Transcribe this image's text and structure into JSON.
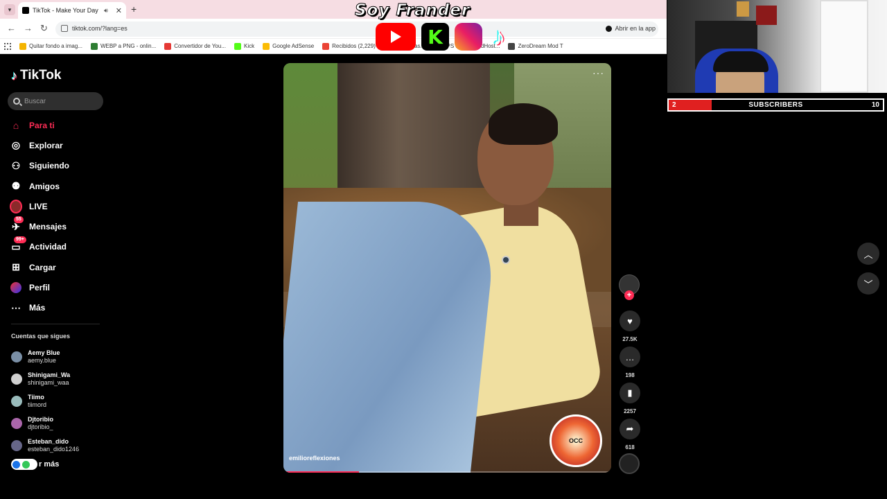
{
  "browser": {
    "tab_title": "TikTok - Make Your Day",
    "url": "tiktok.com/?lang=es",
    "open_in_app": "Abrir en la app",
    "bookmarks": [
      {
        "label": "Quitar fondo a imag...",
        "color": "#f4b400"
      },
      {
        "label": "WEBP a PNG - onlin...",
        "color": "#2e7d32"
      },
      {
        "label": "Convertidor de You...",
        "color": "#e53935"
      },
      {
        "label": "Kick",
        "color": "#53fc18"
      },
      {
        "label": "Google AdSense",
        "color": "#fbbc05"
      },
      {
        "label": "Recibidos (2,229)",
        "color": "#ea4335"
      },
      {
        "label": "Masterclas...",
        "color": "#555555"
      },
      {
        "label": "VPS PRO - ColdHost...",
        "color": "#333333"
      },
      {
        "label": "ZeroDream Mod T",
        "color": "#444444"
      }
    ]
  },
  "overlay": {
    "title": "Soy Frander",
    "social": [
      "youtube-icon",
      "kick-icon",
      "instagram-icon",
      "tiktok-icon"
    ],
    "kick_letter": "K",
    "subscribers": {
      "current": "2",
      "label": "SUBSCRIBERS",
      "goal": "10",
      "progress": 0.2
    }
  },
  "sidebar": {
    "logo": "TikTok",
    "search_placeholder": "Buscar",
    "menu": [
      {
        "label": "Para ti",
        "icon": "home-icon",
        "active": true
      },
      {
        "label": "Explorar",
        "icon": "compass-icon"
      },
      {
        "label": "Siguiendo",
        "icon": "following-icon"
      },
      {
        "label": "Amigos",
        "icon": "friends-icon"
      },
      {
        "label": "LIVE",
        "icon": "live-icon"
      },
      {
        "label": "Mensajes",
        "icon": "messages-icon",
        "badge": "55"
      },
      {
        "label": "Actividad",
        "icon": "activity-icon",
        "badge": "99+"
      },
      {
        "label": "Cargar",
        "icon": "upload-icon"
      },
      {
        "label": "Perfil",
        "icon": "profile-icon"
      },
      {
        "label": "Más",
        "icon": "more-icon"
      }
    ],
    "following_title": "Cuentas que sigues",
    "following": [
      {
        "name": "Aemy Blue",
        "handle": "aemy.blue"
      },
      {
        "name": "Shinigami_Wa",
        "handle": "shinigami_waa"
      },
      {
        "name": "Tiimo",
        "handle": "tiimord"
      },
      {
        "name": "Djtoribio",
        "handle": "djtoribio_"
      },
      {
        "name": "Esteban_dido",
        "handle": "esteban_dido1246"
      }
    ],
    "see_more": "r más"
  },
  "video": {
    "username": "emilioreflexiones",
    "progress": 0.23,
    "badge_text": "OCC"
  },
  "actions": {
    "likes": "27.5K",
    "comments": "198",
    "saves": "2257",
    "shares": "618"
  },
  "colors": {
    "accent": "#fe2c55",
    "sidebar_bg": "#000000"
  }
}
